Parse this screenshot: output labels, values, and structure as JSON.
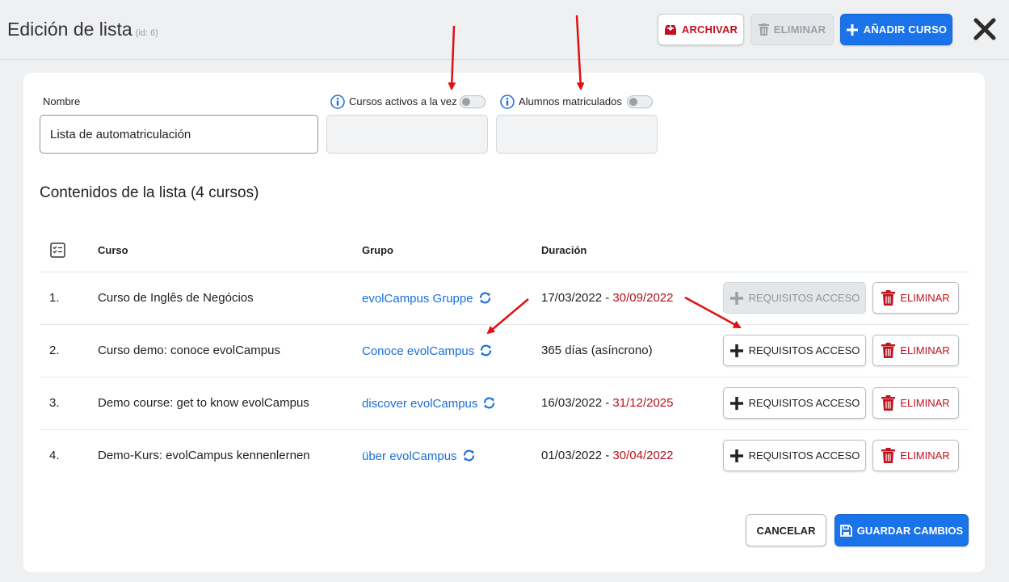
{
  "header": {
    "title": "Edición de lista",
    "id_label": "(id: 6)",
    "archive_label": "ARCHIVAR",
    "delete_label": "ELIMINAR",
    "add_course_label": "AÑADIR CURSO"
  },
  "form": {
    "name_label": "Nombre",
    "name_value": "Lista de automatriculación",
    "active_courses_label": "Cursos activos a la vez",
    "enrolled_label": "Alumnos matriculados"
  },
  "contents": {
    "title": "Contenidos de la lista (4 cursos)",
    "columns": {
      "course": "Curso",
      "group": "Grupo",
      "duration": "Duración"
    },
    "rows": [
      {
        "index": "1.",
        "course": "Curso de Inglês de Negócios",
        "group": "evolCampus Gruppe",
        "start": "17/03/2022",
        "sep": " - ",
        "end": "30/09/2022",
        "duration": "",
        "req_label": "REQUISITOS ACCESO",
        "del_label": "ELIMINAR"
      },
      {
        "index": "2.",
        "course": "Curso demo: conoce evolCampus",
        "group": "Conoce evolCampus",
        "start": "",
        "sep": "",
        "end": "",
        "duration": "365 días (asíncrono)",
        "req_label": "REQUISITOS ACCESO",
        "del_label": "ELIMINAR"
      },
      {
        "index": "3.",
        "course": "Demo course: get to know evolCampus",
        "group": "discover evolCampus",
        "start": "16/03/2022",
        "sep": " - ",
        "end": "31/12/2025",
        "duration": "",
        "req_label": "REQUISITOS ACCESO",
        "del_label": "ELIMINAR"
      },
      {
        "index": "4.",
        "course": "Demo-Kurs: evolCampus kennenlernen",
        "group": "über evolCampus",
        "start": "01/03/2022",
        "sep": " - ",
        "end": "30/04/2022",
        "duration": "",
        "req_label": "REQUISITOS ACCESO",
        "del_label": "ELIMINAR"
      }
    ]
  },
  "footer": {
    "cancel_label": "CANCELAR",
    "save_label": "GUARDAR CAMBIOS"
  },
  "colors": {
    "primary": "#1a73e8",
    "danger": "#c1121f",
    "annotation": "#e01010"
  }
}
